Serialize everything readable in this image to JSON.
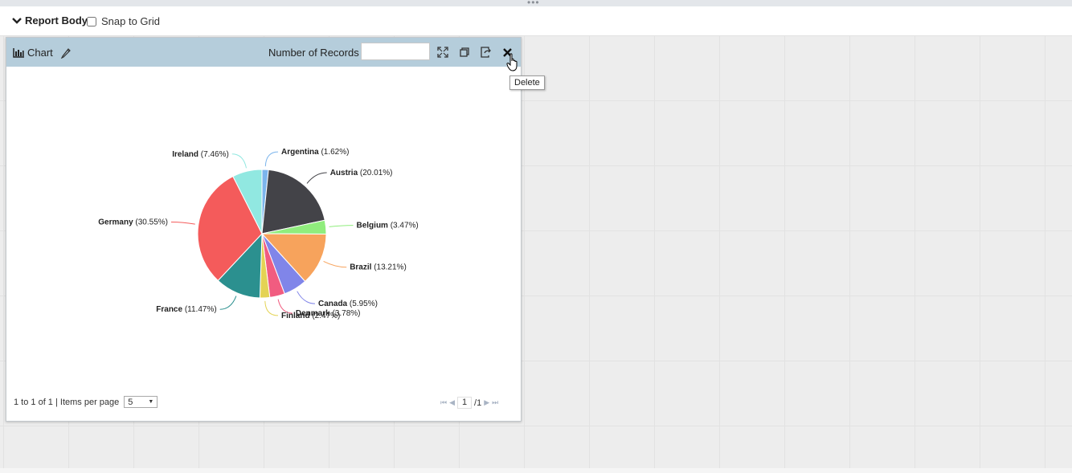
{
  "header": {
    "report_title": "Report Body",
    "snap_label": "Snap to Grid",
    "snap_checked": false
  },
  "panel": {
    "title": "Chart",
    "records_label": "Number of Records",
    "records_value": "",
    "tooltip": "Delete",
    "header_bg": "#b5cddb"
  },
  "pager": {
    "summary": "1 to 1 of 1 | Items per page",
    "items_per_page": "5",
    "page": "1",
    "total": "/1"
  },
  "chart_data": {
    "type": "pie",
    "title": "",
    "slices": [
      {
        "label": "Argentina",
        "pct": "(1.62%)",
        "value": 1.62,
        "color": "#7cb5ec"
      },
      {
        "label": "Austria",
        "pct": "(20.01%)",
        "value": 20.01,
        "color": "#434348"
      },
      {
        "label": "Belgium",
        "pct": "(3.47%)",
        "value": 3.47,
        "color": "#90ed7d"
      },
      {
        "label": "Brazil",
        "pct": "(13.21%)",
        "value": 13.21,
        "color": "#f7a35c"
      },
      {
        "label": "Canada",
        "pct": "(5.95%)",
        "value": 5.95,
        "color": "#8085e9"
      },
      {
        "label": "Denmark",
        "pct": "(3.78%)",
        "value": 3.78,
        "color": "#f15c80"
      },
      {
        "label": "Finland",
        "pct": "(2.47%)",
        "value": 2.47,
        "color": "#e4d354"
      },
      {
        "label": "France",
        "pct": "(11.47%)",
        "value": 11.47,
        "color": "#2b908f"
      },
      {
        "label": "Germany",
        "pct": "(30.55%)",
        "value": 30.55,
        "color": "#f45b5b"
      },
      {
        "label": "Ireland",
        "pct": "(7.46%)",
        "value": 7.46,
        "color": "#91e8e1"
      }
    ]
  }
}
